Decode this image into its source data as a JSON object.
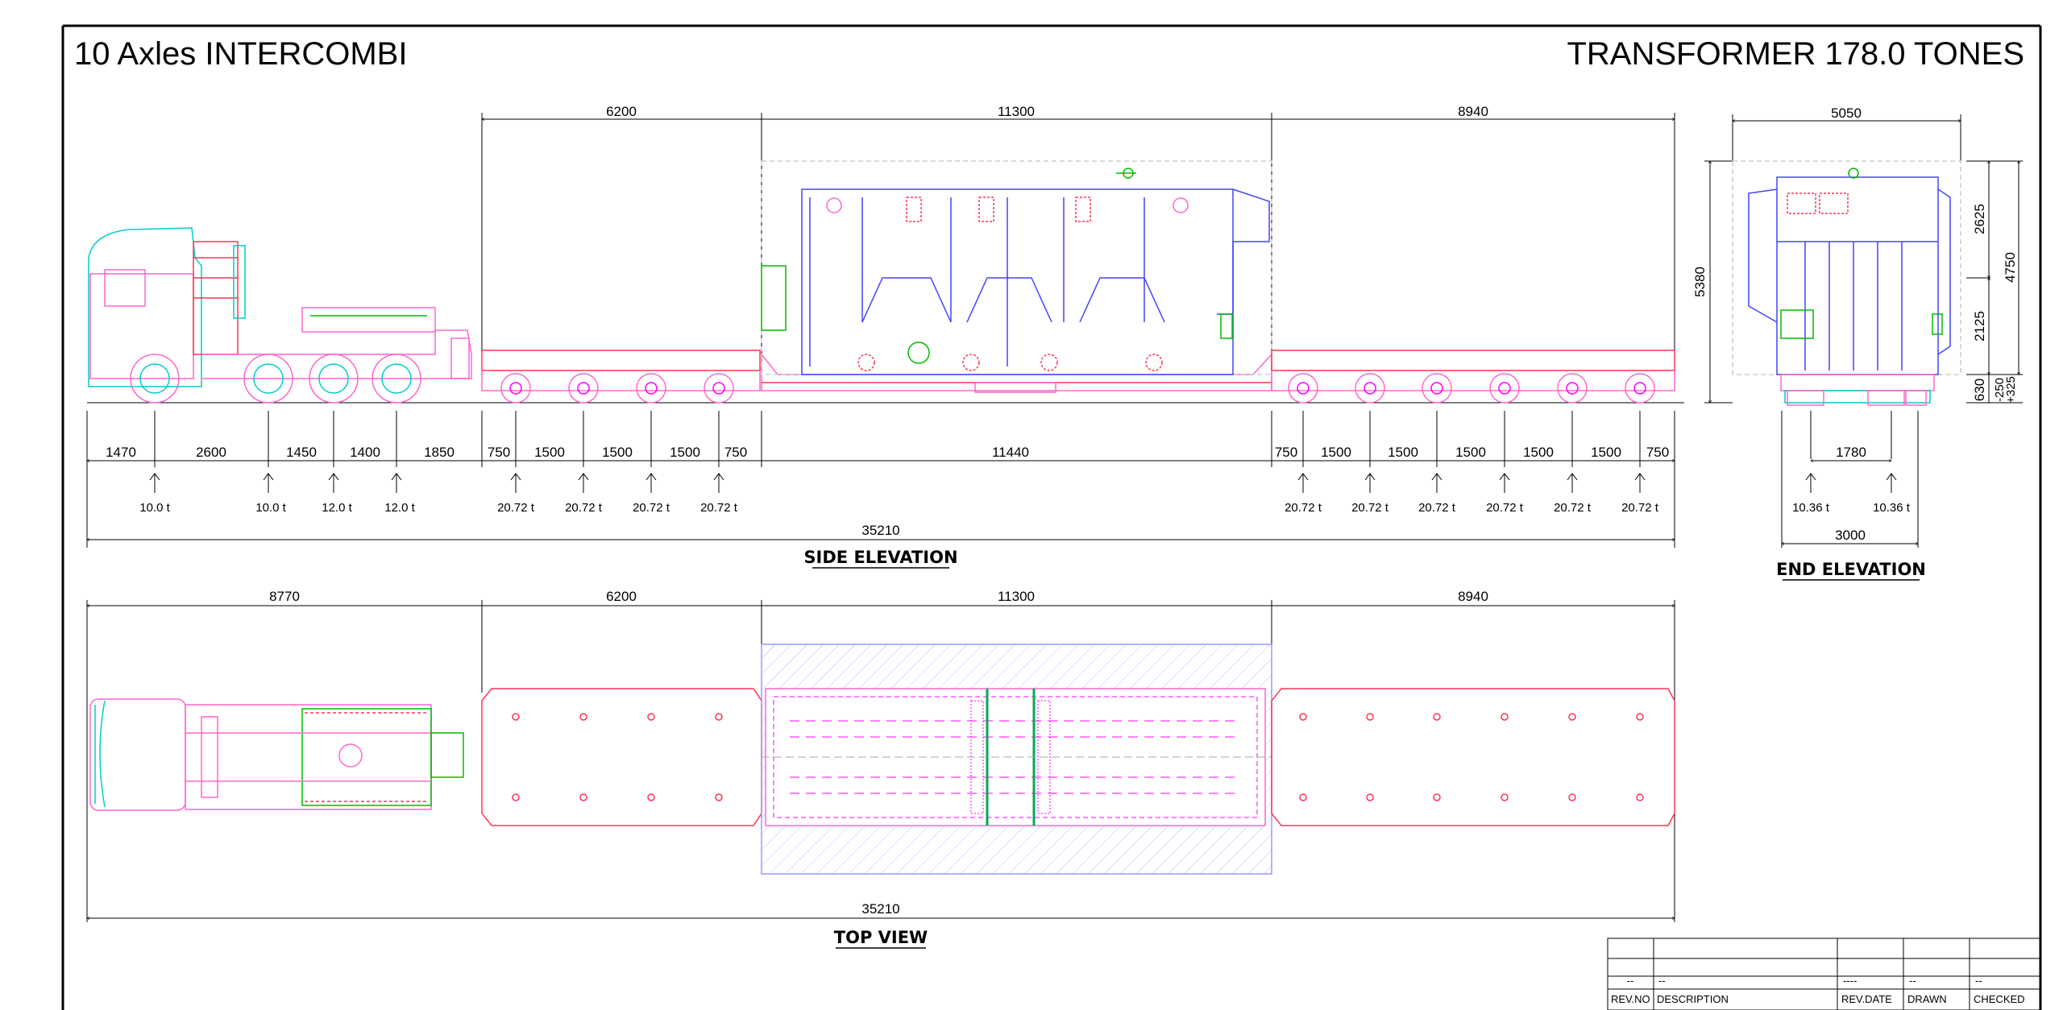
{
  "titles": {
    "left": "10 Axles INTERCOMBI",
    "right": "TRANSFORMER 178.0 TONES"
  },
  "side_elevation": {
    "caption": "SIDE ELEVATION",
    "top_dims": [
      "6200",
      "11300",
      "8940"
    ],
    "bottom_dims": [
      "1470",
      "2600",
      "1450",
      "1400",
      "1850",
      "750",
      "1500",
      "1500",
      "1500",
      "750",
      "11440",
      "750",
      "1500",
      "1500",
      "1500",
      "1500",
      "1500",
      "750"
    ],
    "axle_loads": [
      "10.0 t",
      "10.0 t",
      "12.0 t",
      "12.0 t",
      "20.72 t",
      "20.72 t",
      "20.72 t",
      "20.72 t",
      "20.72 t",
      "20.72 t",
      "20.72 t",
      "20.72 t",
      "20.72 t",
      "20.72 t"
    ],
    "overall": "35210"
  },
  "end_elevation": {
    "caption": "END ELEVATION",
    "top_dim": "5050",
    "left_height": "5380",
    "right_dims": [
      "2625",
      "2125",
      "4750",
      "630"
    ],
    "tolerance": [
      "-250",
      "+325"
    ],
    "axle_spacing": "1780",
    "axle_loads": [
      "10.36 t",
      "10.36 t"
    ],
    "bottom_dim": "3000"
  },
  "top_view": {
    "caption": "TOP VIEW",
    "top_dims": [
      "8770",
      "6200",
      "11300",
      "8940"
    ],
    "overall": "35210"
  },
  "title_block": {
    "row_values": [
      "--",
      "--",
      "----",
      "--",
      "--"
    ],
    "headers": [
      "REV.NO",
      "DESCRIPTION",
      "REV.DATE",
      "DRAWN",
      "CHECKED"
    ]
  },
  "colors": {
    "truck": "#ff66cc",
    "cab": "#00cccc",
    "trailer": "#ff3355",
    "cargo": "#4444ff",
    "fittings": "#00bb00",
    "hatch": "#9999ff"
  }
}
